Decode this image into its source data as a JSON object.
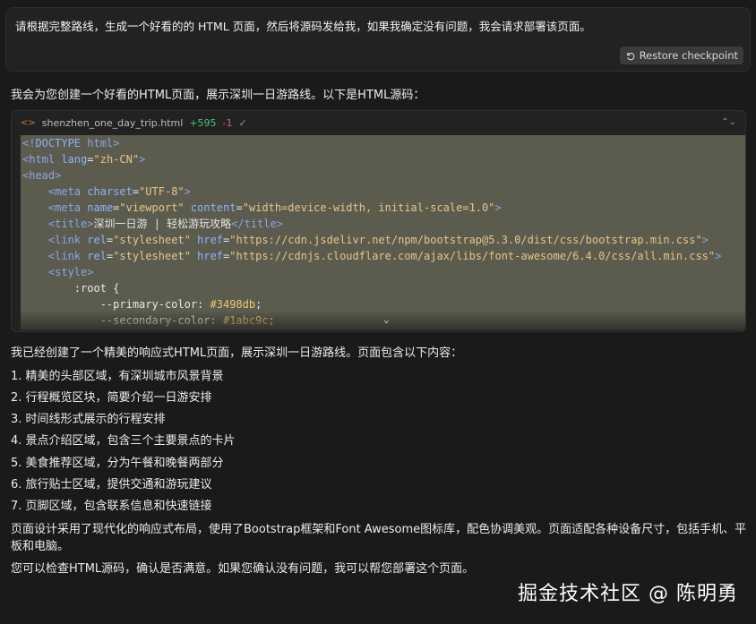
{
  "user_message": {
    "text": "请根据完整路线，生成一个好看的的 HTML 页面，然后将源码发给我，如果我确定没有问题，我会请求部署该页面。",
    "restore_label": "Restore checkpoint",
    "restore_icon": "restore-icon"
  },
  "assistant": {
    "intro": "我会为您创建一个好看的HTML页面，展示深圳一日游路线。以下是HTML源码：",
    "code_block": {
      "filename": "shenzhen_one_day_trip.html",
      "added": "+595",
      "removed": "-1",
      "check": "✓",
      "file_icon": "code-icon",
      "expand_icon": "chevron-up-down-icon",
      "lines": [
        "<!DOCTYPE html>",
        "<html lang=\"zh-CN\">",
        "<head>",
        "    <meta charset=\"UTF-8\">",
        "    <meta name=\"viewport\" content=\"width=device-width, initial-scale=1.0\">",
        "    <title>深圳一日游 | 轻松游玩攻略</title>",
        "    <link rel=\"stylesheet\" href=\"https://cdn.jsdelivr.net/npm/bootstrap@5.3.0/dist/css/bootstrap.min.css\">",
        "    <link rel=\"stylesheet\" href=\"https://cdnjs.cloudflare.com/ajax/libs/font-awesome/6.4.0/css/all.min.css\">",
        "    <style>",
        "        :root {",
        "            --primary-color: #3498db;",
        "            --secondary-color: #1abc9c;"
      ]
    },
    "summary": "我已经创建了一个精美的响应式HTML页面，展示深圳一日游路线。页面包含以下内容：",
    "items": [
      "1. 精美的头部区域，有深圳城市风景背景",
      "2. 行程概览区块，简要介绍一日游安排",
      "3. 时间线形式展示的行程安排",
      "4. 景点介绍区域，包含三个主要景点的卡片",
      "5. 美食推荐区域，分为午餐和晚餐两部分",
      "6. 旅行贴士区域，提供交通和游玩建议",
      "7. 页脚区域，包含联系信息和快速链接"
    ],
    "design_line1": "页面设计采用了现代化的响应式布局，使用了Bootstrap框架和Font Awesome图标库，配色协调美观。页面适配各种设备尺寸，包括手机、平",
    "design_line2": "板和电脑。",
    "closing": "您可以检查HTML源码，确认是否满意。如果您确认没有问题，我可以帮您部署这个页面。"
  },
  "watermark": "掘金技术社区 @ 陈明勇"
}
